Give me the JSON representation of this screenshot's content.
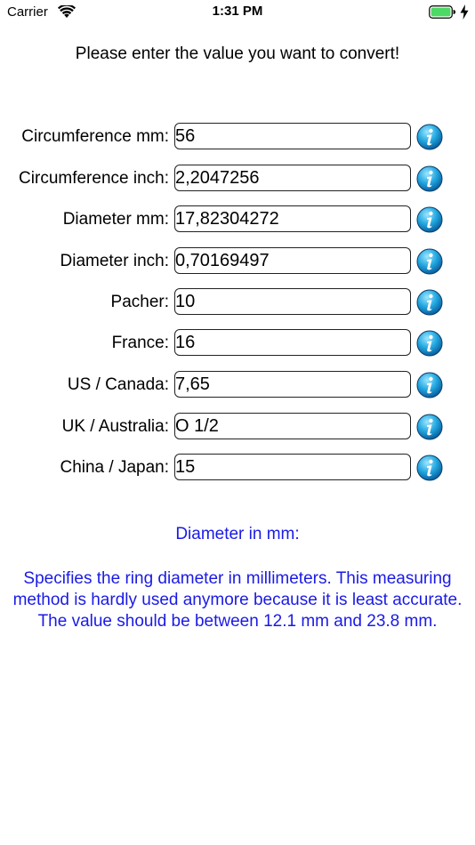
{
  "status_bar": {
    "carrier": "Carrier",
    "time": "1:31 PM"
  },
  "prompt": "Please enter the value you want to convert!",
  "fields": [
    {
      "label": "Circumference mm:",
      "value": "56"
    },
    {
      "label": "Circumference inch:",
      "value": "2,2047256"
    },
    {
      "label": "Diameter mm:",
      "value": "17,82304272"
    },
    {
      "label": "Diameter inch:",
      "value": "0,70169497"
    },
    {
      "label": "Pacher:",
      "value": "10"
    },
    {
      "label": "France:",
      "value": "16"
    },
    {
      "label": "US / Canada:",
      "value": "7,65"
    },
    {
      "label": "UK / Australia:",
      "value": "O 1/2"
    },
    {
      "label": "China / Japan:",
      "value": "15"
    }
  ],
  "description": {
    "title": "Diameter in mm:",
    "body": "Specifies the ring diameter in millimeters. This measuring method is hardly used anymore because it is least accurate.\n The value should be between 12.1 mm and 23.8 mm."
  },
  "colors": {
    "description_text": "#1a1ae6",
    "info_icon": "#1d9fd8",
    "battery": "#4cd964"
  },
  "icons": {
    "wifi": "wifi-icon",
    "battery": "battery-icon",
    "charging": "charging-bolt-icon",
    "info": "info-icon"
  }
}
